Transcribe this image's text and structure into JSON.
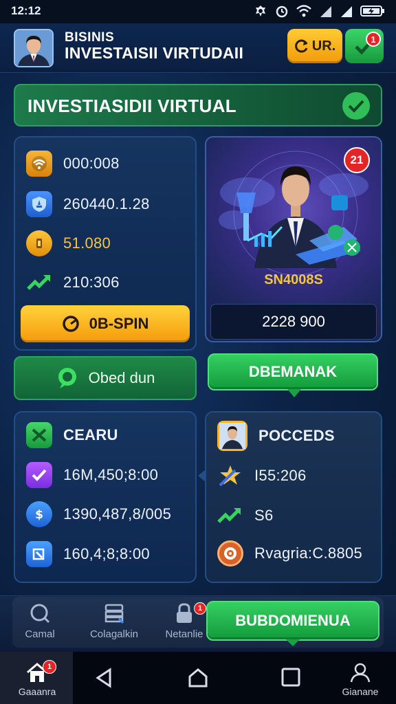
{
  "status_bar": {
    "time": "12:12",
    "icons": [
      "settings-icon",
      "alarm-icon",
      "wifi-icon",
      "signal-icon",
      "signal-icon",
      "battery-icon"
    ]
  },
  "header": {
    "subtitle": "BISINIS",
    "title": "INVESTAISII VIRTUDAII",
    "ur_button_label": "UR.",
    "notification_count": "1"
  },
  "banner": {
    "title": "INVESTIASIDII VIRTUAL"
  },
  "stats_panel": {
    "rows": [
      {
        "icon": "wifi-coin-icon",
        "value": "000:008"
      },
      {
        "icon": "shield-icon",
        "value": "260440.1.28"
      },
      {
        "icon": "coin-icon",
        "value": "51.080"
      },
      {
        "icon": "trend-up-icon",
        "value": "210:306"
      }
    ],
    "spin_button_label": "0B-SPIN"
  },
  "promo_panel": {
    "badge": "21",
    "code": "SN4008S",
    "amount": "2228 900",
    "action_label": "DBEMANAK"
  },
  "used_button_label": "Obed dun",
  "left_list": {
    "title": "CEARU",
    "rows": [
      {
        "icon": "check-icon",
        "value": "16M,450;8:00"
      },
      {
        "icon": "dollar-icon",
        "value": "1390,487,8/005"
      },
      {
        "icon": "transfer-icon",
        "value": "160,4;8;8:00"
      }
    ]
  },
  "right_list": {
    "title": "POCCEDS",
    "rows": [
      {
        "icon": "star-arrow-icon",
        "value": "I55:206"
      },
      {
        "icon": "trend-up-icon",
        "value": "S6"
      },
      {
        "icon": "target-icon",
        "value": "Rvagria:C.8805"
      }
    ]
  },
  "bottom_nav": {
    "items": [
      {
        "label": "Camal",
        "icon": "search-icon"
      },
      {
        "label": "Colagalkin",
        "icon": "bank-icon"
      },
      {
        "label": "Netanlie",
        "icon": "lock-icon",
        "badge": "1"
      }
    ],
    "cta_label": "BUBDOMIENUA"
  },
  "system_bar": {
    "home_label": "Gaaanra",
    "home_badge": "1",
    "profile_label": "Gianane"
  },
  "colors": {
    "background": "#0c2347",
    "accent_green": "#2fbe58",
    "accent_orange": "#f5a611",
    "gold_text": "#f5c542"
  }
}
